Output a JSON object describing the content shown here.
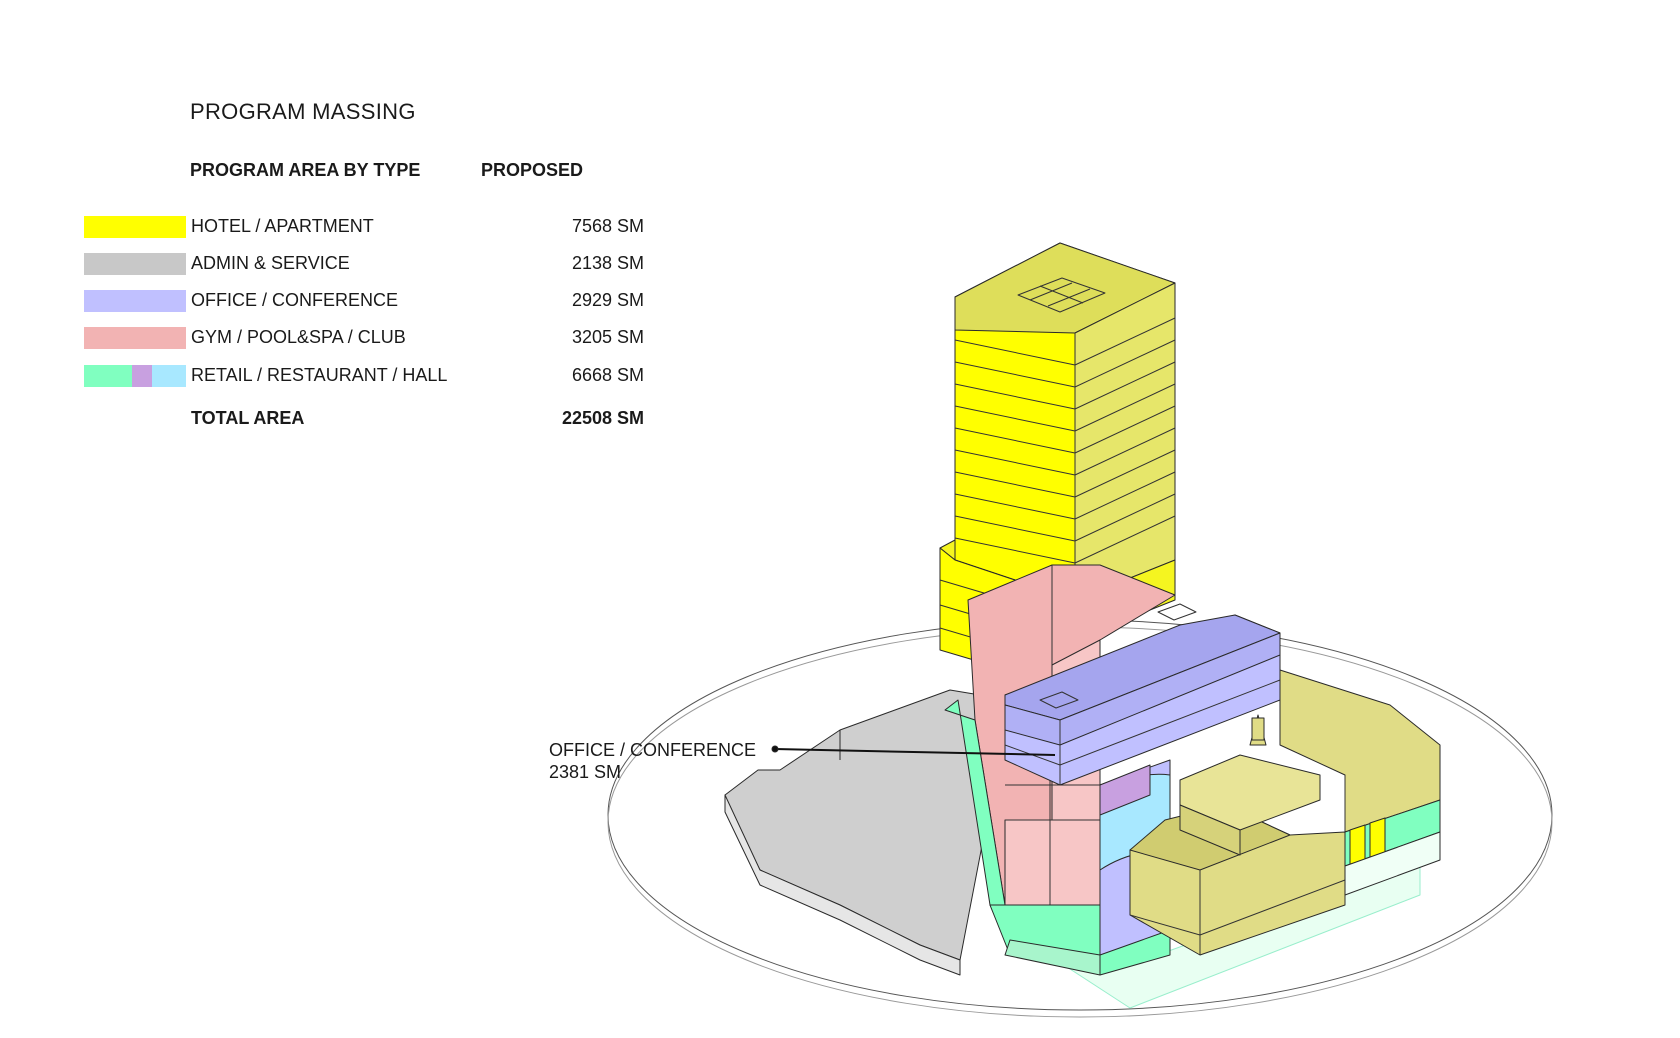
{
  "title": "PROGRAM MASSING",
  "table": {
    "col_type": "PROGRAM AREA BY TYPE",
    "col_proposed": "PROPOSED",
    "rows": [
      {
        "label": "HOTEL / APARTMENT",
        "value": "7568 SM",
        "colors": [
          "#ffff00"
        ]
      },
      {
        "label": "ADMIN & SERVICE",
        "value": "2138 SM",
        "colors": [
          "#c8c8c8"
        ]
      },
      {
        "label": "OFFICE / CONFERENCE",
        "value": "2929 SM",
        "colors": [
          "#c0c0ff"
        ]
      },
      {
        "label": "GYM / POOL&SPA / CLUB",
        "value": "3205 SM",
        "colors": [
          "#f2b3b3"
        ]
      },
      {
        "label": "RETAIL / RESTAURANT / HALL",
        "value": "6668 SM",
        "colors": [
          "#80ffc0",
          "#c8a0e0",
          "#a8e8ff"
        ]
      }
    ],
    "total_label": "TOTAL AREA",
    "total_value": "22508 SM"
  },
  "callout": {
    "label": "OFFICE / CONFERENCE",
    "value": "2381 SM"
  },
  "colors": {
    "hotel": "#ffff00",
    "hotel_shade": "#dede5a",
    "admin": "#c8c8c8",
    "office": "#c0c0ff",
    "office_top": "#a5a5ee",
    "gym": "#f2b3b3",
    "retail_green": "#80ffc0",
    "retail_purple": "#c8a0e0",
    "retail_blue": "#a8e8ff",
    "heritage": "#e0dc86"
  }
}
